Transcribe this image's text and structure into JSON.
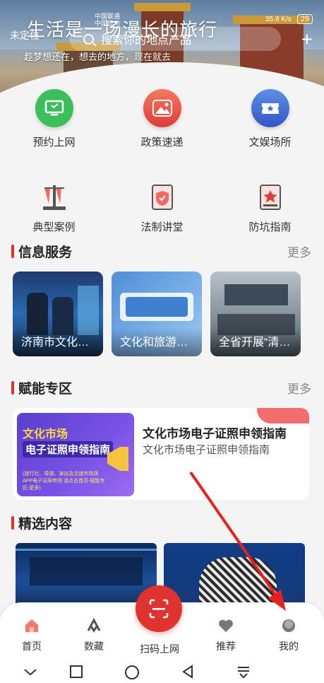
{
  "status": {
    "carrier_line1": "中国联通",
    "carrier_line2": "中国移动",
    "speed": "35.8",
    "speed_unit": "K/s",
    "battery": "29"
  },
  "header": {
    "slogan": "生活是一场漫长的旅行",
    "subslogan": "趁梦想还在，想去的地方，现在就去",
    "location": "未定位",
    "search_placeholder": "搜索你的地点产品",
    "add_label": "+"
  },
  "quick_actions": [
    {
      "label": "预约上网",
      "icon": "monitor-icon",
      "color": "#3bbf5a"
    },
    {
      "label": "政策速递",
      "icon": "mountain-icon",
      "color": "#ef5a4c"
    },
    {
      "label": "文娱场所",
      "icon": "ticket-icon",
      "color": "#3f6fd6"
    }
  ],
  "law_actions": [
    {
      "label": "典型案例",
      "icon": "scales-icon"
    },
    {
      "label": "法制讲堂",
      "icon": "shield-doc-icon"
    },
    {
      "label": "防坑指南",
      "icon": "star-book-icon"
    }
  ],
  "info_section": {
    "title": "信息服务",
    "more": "更多",
    "cards": [
      {
        "caption": "济南市文化和旅游局"
      },
      {
        "caption": "文化和旅游部通知"
      },
      {
        "caption": "全省开展“清朗”行动"
      }
    ]
  },
  "enable_section": {
    "title": "赋能专区",
    "more": "更多",
    "card": {
      "thumb_title": "文化市场",
      "thumb_subtitle": "电子证照申领指南",
      "thumb_note": "(旅行社、导游、演出及文旅市场场APP电子证照申领 请点击首页-赋能专区-更多)",
      "title": "文化市场电子证照申领指南",
      "subtitle": "文化市场电子证照申领指南"
    }
  },
  "featured_section": {
    "title": "精选内容"
  },
  "tabbar": {
    "home": "首页",
    "collect": "数藏",
    "scan": "扫码上网",
    "recommend": "推荐",
    "mine": "我的"
  },
  "colors": {
    "accent": "#d6322e",
    "scan_button": "#e0332f",
    "annotation_arrow": "#e8211c"
  }
}
